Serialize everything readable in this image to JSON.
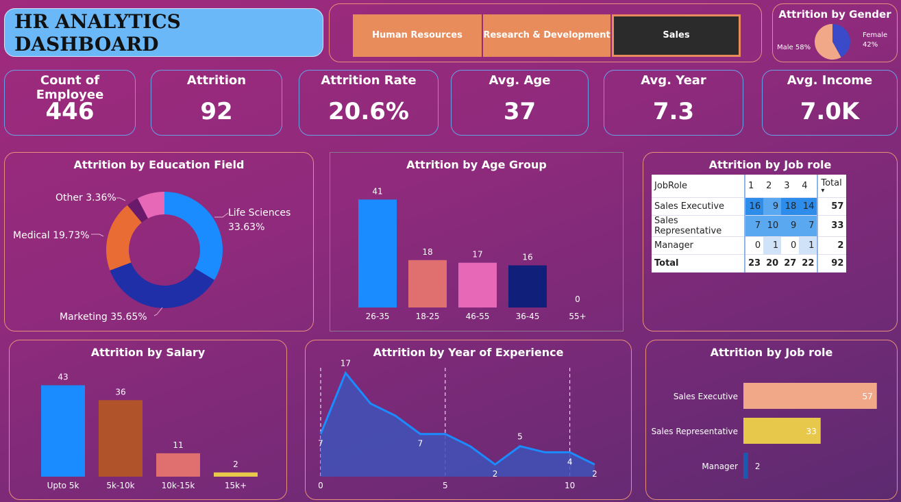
{
  "header": {
    "title": "HR ANALYTICS DASHBOARD"
  },
  "department_slicer": {
    "buttons": [
      "Human Resources",
      "Research & Development",
      "Sales"
    ],
    "selected": "Sales"
  },
  "kpis": [
    {
      "label": "Count of Employee",
      "value": "446"
    },
    {
      "label": "Attrition",
      "value": "92"
    },
    {
      "label": "Attrition Rate",
      "value": "20.6%"
    },
    {
      "label": "Avg. Age",
      "value": "37"
    },
    {
      "label": "Avg. Year",
      "value": "7.3"
    },
    {
      "label": "Avg. Income",
      "value": "7.0K"
    }
  ],
  "colors": {
    "blue": "#1a8cff",
    "brown": "#b0532a",
    "salmon": "#e07070",
    "pink": "#e868b8",
    "navy": "#0f1f7a",
    "yellow": "#e8c84a",
    "peach": "#f0a888",
    "orange": "#e86c34",
    "purple": "#6a1a6a"
  },
  "chart_data": [
    {
      "id": "gender",
      "type": "pie",
      "title": "Attrition by Gender",
      "labels": [
        "Male",
        "Female"
      ],
      "values": [
        58,
        42
      ],
      "display": [
        "Male 58%",
        "Female\n42%"
      ]
    },
    {
      "id": "education",
      "type": "pie",
      "title": "Attrition by Education Field",
      "labels": [
        "Life Sciences",
        "Marketing",
        "Medical",
        "Other"
      ],
      "values": [
        33.63,
        35.65,
        19.73,
        3.36
      ],
      "display": [
        "Life Sciences\n33.63%",
        "Marketing 35.65%",
        "Medical 19.73%",
        "Other 3.36%"
      ],
      "unlabeled_slices": [
        7.63
      ]
    },
    {
      "id": "age",
      "type": "bar",
      "title": "Attrition by Age Group",
      "categories": [
        "26-35",
        "18-25",
        "46-55",
        "36-45",
        "55+"
      ],
      "values": [
        41,
        18,
        17,
        16,
        0
      ],
      "ylim": [
        0,
        45
      ]
    },
    {
      "id": "jobrole_matrix",
      "type": "table",
      "title": "Attrition by Job role",
      "columns": [
        "JobRole",
        "1",
        "2",
        "3",
        "4",
        "Total"
      ],
      "rows": [
        [
          "Sales Executive",
          "16",
          "9",
          "18",
          "14",
          "57"
        ],
        [
          "Sales Representative",
          "7",
          "10",
          "9",
          "7",
          "33"
        ],
        [
          "Manager",
          "0",
          "1",
          "0",
          "1",
          "2"
        ]
      ],
      "total_row": [
        "Total",
        "23",
        "20",
        "27",
        "22",
        "92"
      ]
    },
    {
      "id": "salary",
      "type": "bar",
      "title": "Attrition by Salary",
      "categories": [
        "Upto 5k",
        "5k-10k",
        "10k-15k",
        "15k+"
      ],
      "values": [
        43,
        36,
        11,
        2
      ],
      "ylim": [
        0,
        48
      ]
    },
    {
      "id": "experience",
      "type": "area",
      "title": "Attrition by Year of Experience",
      "x": [
        0,
        1,
        2,
        3,
        4,
        5,
        6,
        7,
        8,
        9,
        10,
        11
      ],
      "values": [
        7,
        17,
        12,
        10,
        7,
        7,
        5,
        2,
        5,
        4,
        4,
        2
      ],
      "data_labels": {
        "0": "7",
        "1": "17",
        "4": "7",
        "7": "2",
        "8": "5",
        "10": "4",
        "11": "2"
      },
      "xticks": [
        0,
        5,
        10
      ],
      "ylim": [
        0,
        20
      ]
    },
    {
      "id": "jobrole_bar",
      "type": "bar",
      "title": "Attrition by Job role",
      "orientation": "horizontal",
      "categories": [
        "Sales Executive",
        "Sales Representative",
        "Manager"
      ],
      "values": [
        57,
        33,
        2
      ],
      "xlim": [
        0,
        60
      ]
    }
  ]
}
